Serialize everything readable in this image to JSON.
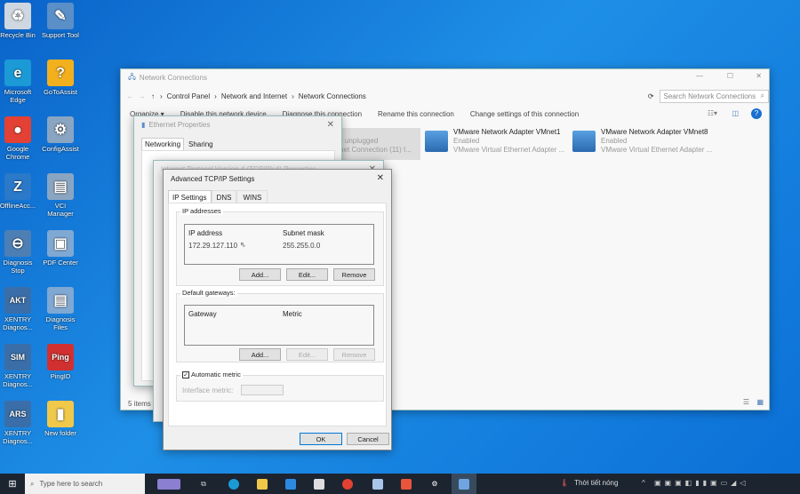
{
  "desktop": {
    "icons": [
      {
        "label": "Recycle Bin",
        "color": "#cfd8e0",
        "glyph": "♻"
      },
      {
        "label": "Support Tool",
        "color": "#5a8fc8",
        "glyph": "✎"
      },
      {
        "label": "Microsoft Edge",
        "color": "#1b9ad6",
        "glyph": "e"
      },
      {
        "label": "GoToAssist",
        "color": "#f2b01e",
        "glyph": "?"
      },
      {
        "label": "Google Chrome",
        "color": "#e34133",
        "glyph": "●"
      },
      {
        "label": "ConfigAssist",
        "color": "#8aa5c2",
        "glyph": "⚙"
      },
      {
        "label": "OfflineAcc...",
        "color": "#2b79c9",
        "glyph": "Z"
      },
      {
        "label": "VCI Manager",
        "color": "#8aa5c2",
        "glyph": "▤"
      },
      {
        "label": "Diagnosis Stop",
        "color": "#4d7fb5",
        "glyph": "⊖"
      },
      {
        "label": "PDF Center",
        "color": "#7fa8d3",
        "glyph": "▣"
      },
      {
        "label": "XENTRY Diagnos...",
        "color": "#3a6ea8",
        "glyph": "AKT"
      },
      {
        "label": "Diagnosis Files",
        "color": "#7fa8d3",
        "glyph": "▤"
      },
      {
        "label": "XENTRY Diagnos...",
        "color": "#3a6ea8",
        "glyph": "SIM"
      },
      {
        "label": "PingID",
        "color": "#d03030",
        "glyph": "Ping"
      },
      {
        "label": "XENTRY Diagnos...",
        "color": "#3a6ea8",
        "glyph": "ARS"
      },
      {
        "label": "New folder",
        "color": "#f0c84a",
        "glyph": "▮"
      }
    ]
  },
  "explorer": {
    "title": "Network Connections",
    "breadcrumb": [
      "Control Panel",
      "Network and Internet",
      "Network Connections"
    ],
    "search_placeholder": "Search Network Connections",
    "toolbar": [
      "Organize ▾",
      "Disable this network device",
      "Diagnose this connection",
      "Rename this connection",
      "Change settings of this connection"
    ],
    "partial_item": {
      "line1": "ble unplugged",
      "line2": "ernet Connection (11) I..."
    },
    "items": [
      {
        "name": "VMware Network Adapter VMnet1",
        "status": "Enabled",
        "device": "VMware Virtual Ethernet Adapter ..."
      },
      {
        "name": "VMware Network Adapter VMnet8",
        "status": "Enabled",
        "device": "VMware Virtual Ethernet Adapter ..."
      }
    ],
    "status": "5 items"
  },
  "ethernet": {
    "title": "Ethernet Properties",
    "tabs": [
      "Networking",
      "Sharing"
    ]
  },
  "ipv4": {
    "title": "Internet Protocol Version 4 (TCP/IPv4) Properties"
  },
  "advanced": {
    "title": "Advanced TCP/IP Settings",
    "tabs": [
      "IP Settings",
      "DNS",
      "WINS"
    ],
    "ip_group": "IP addresses",
    "ip_headers": [
      "IP address",
      "Subnet mask"
    ],
    "ip_rows": [
      [
        "172.29.127.110",
        "255.255.0.0"
      ]
    ],
    "gw_group": "Default gateways:",
    "gw_headers": [
      "Gateway",
      "Metric"
    ],
    "add": "Add...",
    "edit": "Edit...",
    "remove": "Remove",
    "auto_metric": "Automatic metric",
    "auto_metric_checked": true,
    "interface_metric": "Interface metric:",
    "ok": "OK",
    "cancel": "Cancel"
  },
  "taskbar": {
    "search_placeholder": "Type here to search",
    "weather": "Thời tiết nóng"
  }
}
